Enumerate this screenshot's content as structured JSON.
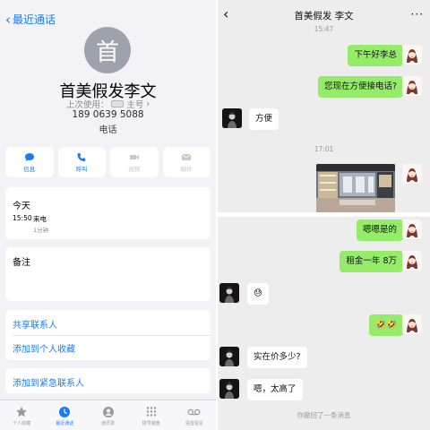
{
  "contact": {
    "back_label": "最近通话",
    "avatar_initial": "首",
    "name": "首美假发李文",
    "last_used_prefix": "上次使用：",
    "last_used_value": "主号",
    "phone": "189 0639 5088",
    "phone_label": "电话",
    "actions": [
      "信息",
      "呼叫",
      "视频",
      "邮件"
    ],
    "recent_calls": {
      "title": "今天",
      "time": "15:50",
      "type": "来电",
      "duration": "1分钟"
    },
    "notes_label": "备注",
    "links": {
      "share": "共享联系人",
      "favorites": "添加到个人收藏",
      "emergency": "添加到紧急联系人"
    },
    "tabbar": [
      "个人收藏",
      "最近通话",
      "通讯录",
      "拨号键盘",
      "语音留言"
    ],
    "active_tab": "最近通话",
    "accent_color": "#1a7cf5"
  },
  "chat_top": {
    "title": "首美假发 李文",
    "top_timestamp": "15:47",
    "messages": [
      {
        "from": "me",
        "text": "下午好李总"
      },
      {
        "from": "me",
        "text": "您现在方便接电话?"
      },
      {
        "from": "them",
        "text": "方便"
      }
    ],
    "timestamp2": "17:01",
    "image_message": {
      "from": "me",
      "kind": "photo"
    }
  },
  "chat_bottom": {
    "messages": [
      {
        "from": "me",
        "text": "嗯嗯是的"
      },
      {
        "from": "me",
        "text": "租金一年 8万"
      },
      {
        "from": "them",
        "text": "😓"
      },
      {
        "from": "me",
        "text": "🤣🤣"
      },
      {
        "from": "them",
        "text": "实在价多少?"
      },
      {
        "from": "them",
        "text": "嗯，太高了"
      }
    ],
    "recall_note": "你撤回了一条消息"
  },
  "colors": {
    "wechat_green": "#95ec69",
    "chat_background": "#ededed",
    "ios_background": "#f2f2f7"
  }
}
